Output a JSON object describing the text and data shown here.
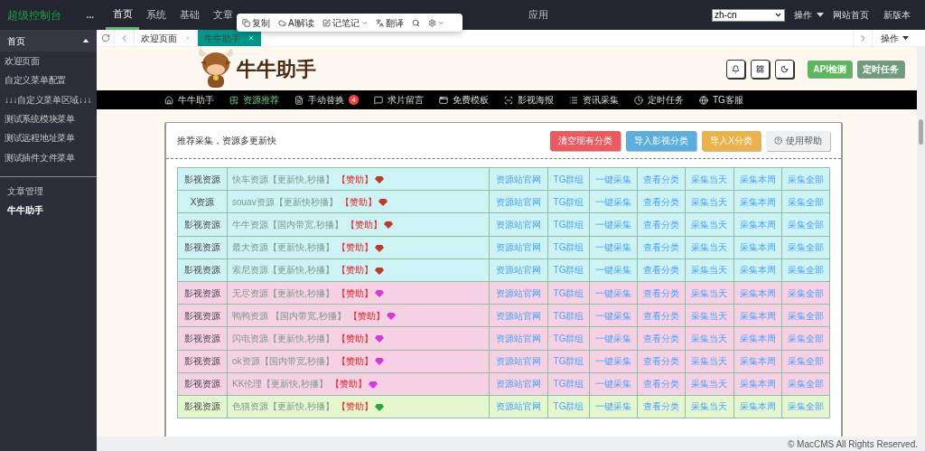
{
  "topbar": {
    "brand": "超级控制台",
    "more": "...",
    "nav": [
      {
        "label": "首页",
        "selected": true
      },
      {
        "label": "系统",
        "selected": false
      },
      {
        "label": "基础",
        "selected": false
      },
      {
        "label": "文章",
        "selected": false
      }
    ],
    "nav_end": {
      "label": "应用",
      "selected": false
    },
    "language": "zh-cn",
    "actions": [
      {
        "label": "操作",
        "kind": "dropdown"
      },
      {
        "label": "网站首页",
        "kind": "link"
      },
      {
        "label": "新版本",
        "kind": "link"
      }
    ]
  },
  "popup_toolbar": [
    {
      "label": "复制",
      "kind": "copy"
    },
    {
      "label": "AI解读",
      "kind": "ai"
    },
    {
      "label": "记笔记",
      "kind": "note"
    },
    {
      "label": "翻译",
      "kind": "translate"
    },
    {
      "kind": "search"
    },
    {
      "kind": "settings"
    }
  ],
  "sidebar": {
    "header": {
      "label": "首页",
      "expanded": true
    },
    "items": [
      {
        "label": "欢迎页面",
        "selected": false
      },
      {
        "label": "自定义菜单配置",
        "selected": false
      },
      {
        "label": "↓↓↓自定义菜单区域↓↓↓",
        "selected": false
      },
      {
        "label": "测试系统模块菜单",
        "selected": false
      },
      {
        "label": "测试远程地址菜单",
        "selected": false
      },
      {
        "label": "测试插件文件菜单",
        "selected": false
      }
    ],
    "groups": [
      {
        "label": "文章管理",
        "selected": false
      },
      {
        "label": "牛牛助手",
        "selected": true
      }
    ]
  },
  "tabs": [
    {
      "label": "欢迎页面",
      "selected": false
    },
    {
      "label": "牛牛助手",
      "selected": true
    }
  ],
  "tab_actions": "操作",
  "plugin": {
    "title": "牛牛助手",
    "header_buttons": [
      {
        "label": "API检测",
        "kind": "green"
      },
      {
        "label": "定时任务",
        "kind": "gray"
      }
    ],
    "nav": [
      {
        "label": "牛牛助手",
        "selected": false
      },
      {
        "label": "资源推荐",
        "selected": true
      },
      {
        "label": "手动替换",
        "selected": false,
        "badge": "4"
      },
      {
        "label": "求片留言",
        "selected": false
      },
      {
        "label": "免费模板",
        "selected": false
      },
      {
        "label": "影视海报",
        "selected": false
      },
      {
        "label": "资讯采集",
        "selected": false
      },
      {
        "label": "定时任务",
        "selected": false
      },
      {
        "label": "TG客服",
        "selected": false
      }
    ]
  },
  "card": {
    "title": "推荐采集，资源多更新快",
    "buttons": [
      {
        "label": "清空现有分类",
        "kind": "danger"
      },
      {
        "label": "导入影视分类",
        "kind": "info"
      },
      {
        "label": "导入X分类",
        "kind": "warning"
      },
      {
        "label": "使用帮助",
        "kind": "help"
      }
    ],
    "rows": [
      {
        "kind": "ruby",
        "type": "影视资源",
        "name": "快车资源【更新快,秒播】",
        "tag": "【赞助】",
        "links": [
          "资源站官网",
          "TG群组",
          "一键采集",
          "查看分类",
          "采集当天",
          "采集本周",
          "采集全部"
        ]
      },
      {
        "kind": "ruby",
        "type": "X资源",
        "name": "souav资源【更新快秒播】",
        "tag": "【赞助】",
        "links": [
          "资源站官网",
          "TG群组",
          "一键采集",
          "查看分类",
          "采集当天",
          "采集本周",
          "采集全部"
        ]
      },
      {
        "kind": "ruby",
        "type": "影视资源",
        "name": "牛牛资源【国内带宽,秒播】",
        "tag": "【赞助】",
        "links": [
          "资源站官网",
          "TG群组",
          "一键采集",
          "查看分类",
          "采集当天",
          "采集本周",
          "采集全部"
        ]
      },
      {
        "kind": "ruby",
        "type": "影视资源",
        "name": "最大资源【更新快,秒播】",
        "tag": "【赞助】",
        "links": [
          "资源站官网",
          "TG群组",
          "一键采集",
          "查看分类",
          "采集当天",
          "采集本周",
          "采集全部"
        ]
      },
      {
        "kind": "ruby",
        "type": "影视资源",
        "name": "索尼资源【更新快,秒播】",
        "tag": "【赞助】",
        "links": [
          "资源站官网",
          "TG群组",
          "一键采集",
          "查看分类",
          "采集当天",
          "采集本周",
          "采集全部"
        ]
      },
      {
        "kind": "amethyst",
        "type": "影视资源",
        "name": "无尽资源【更新快,秒播】",
        "tag": "【赞助】",
        "links": [
          "资源站官网",
          "TG群组",
          "一键采集",
          "查看分类",
          "采集当天",
          "采集本周",
          "采集全部"
        ]
      },
      {
        "kind": "amethyst",
        "type": "影视资源",
        "name": "鸭鸭资源 【国内带宽,秒播】",
        "tag": "【赞助】",
        "links": [
          "资源站官网",
          "TG群组",
          "一键采集",
          "查看分类",
          "采集当天",
          "采集本周",
          "采集全部"
        ]
      },
      {
        "kind": "amethyst",
        "type": "影视资源",
        "name": "闪电资源【更新快,秒播】",
        "tag": "【赞助】",
        "links": [
          "资源站官网",
          "TG群组",
          "一键采集",
          "查看分类",
          "采集当天",
          "采集本周",
          "采集全部"
        ]
      },
      {
        "kind": "amethyst",
        "type": "影视资源",
        "name": "ok资源【国内带宽,秒播】",
        "tag": "【赞助】",
        "links": [
          "资源站官网",
          "TG群组",
          "一键采集",
          "查看分类",
          "采集当天",
          "采集本周",
          "采集全部"
        ]
      },
      {
        "kind": "amethyst",
        "type": "影视资源",
        "name": "KK伦理【更新快,秒播】",
        "tag": "【赞助】",
        "links": [
          "资源站官网",
          "TG群组",
          "一键采集",
          "查看分类",
          "采集当天",
          "采集本周",
          "采集全部"
        ]
      },
      {
        "kind": "emerald",
        "type": "影视资源",
        "name": "色猫资源【更新快,秒播】",
        "tag": "【赞助】",
        "links": [
          "资源站官网",
          "TG群组",
          "一键采集",
          "查看分类",
          "采集当天",
          "采集本周",
          "采集全部"
        ]
      }
    ]
  },
  "footer": "© MacCMS All Rights Reserved."
}
